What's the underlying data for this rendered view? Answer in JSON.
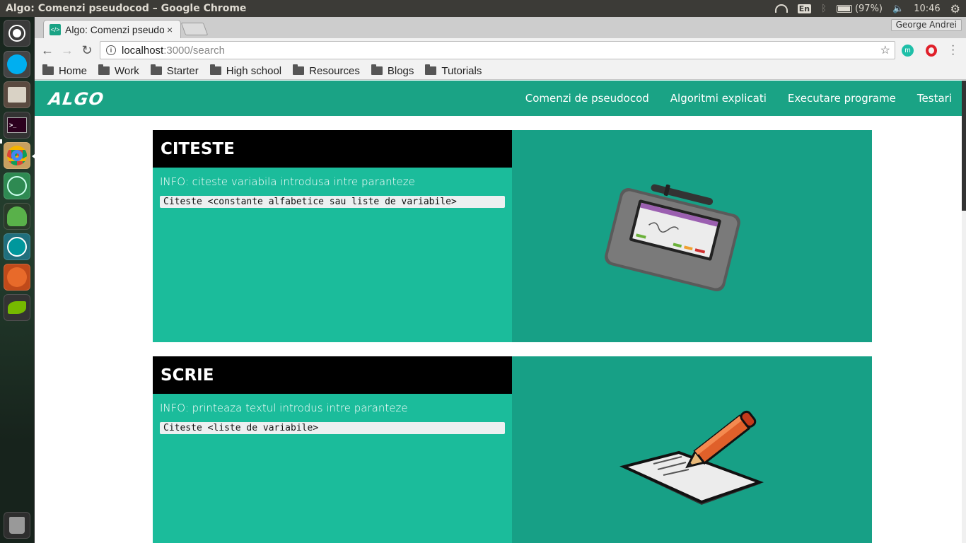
{
  "os": {
    "window_title": "Algo: Comenzi pseudocod – Google Chrome",
    "keyboard": "En",
    "battery": "(97%)",
    "clock": "10:46"
  },
  "browser": {
    "tab_title": "Algo: Comenzi pseudocod",
    "tab_close": "×",
    "profile": "George Andrei",
    "url_host": "localhost",
    "url_path": ":3000/search",
    "bookmarks": [
      "Home",
      "Work",
      "Starter",
      "High school",
      "Resources",
      "Blogs",
      "Tutorials"
    ]
  },
  "site": {
    "logo": "ALGO",
    "nav": [
      "Comenzi de pseudocod",
      "Algoritmi explicati",
      "Executare programe",
      "Testari"
    ]
  },
  "cards": [
    {
      "title": "CITESTE",
      "info": "INFO: citeste variabila introdusa intre paranteze",
      "code": "Citeste <constante alfabetice sau liste de variabile>",
      "image": "signature-pad"
    },
    {
      "title": "SCRIE",
      "info": "INFO: printeaza textul introdus intre paranteze",
      "code": "Citeste <liste de variabile>",
      "image": "pencil-paper"
    }
  ],
  "colors": {
    "brand": "#1aa385",
    "card_left": "#1bbc9b",
    "card_right": "#17a086"
  }
}
